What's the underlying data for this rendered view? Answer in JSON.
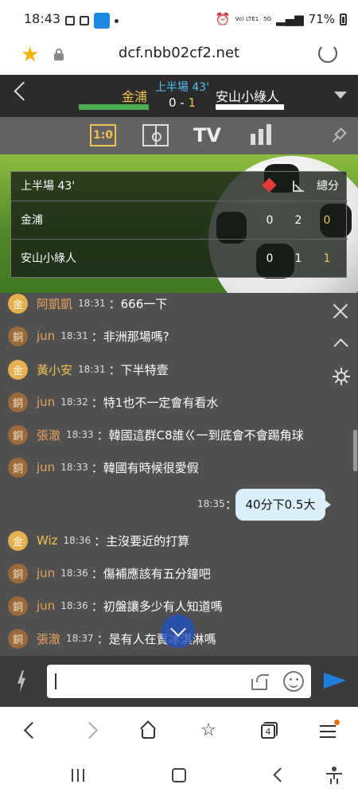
{
  "status_bar": {
    "time": "18:43",
    "lte_label": "Vo) LTE1",
    "net_label": "5G",
    "battery": "71%"
  },
  "browser": {
    "url": "dcf.nbb02cf2.net"
  },
  "match": {
    "home_team": "金浦",
    "away_team": "安山小綠人",
    "period": "上半場 43'",
    "home_score": "0",
    "score_sep": " - ",
    "away_score": "1"
  },
  "tabs": {
    "score_label": "1:0",
    "tv_label": "TV"
  },
  "scoreboard": {
    "period": "上半場 43'",
    "total_header": "總分",
    "rows": [
      {
        "team": "金浦",
        "red_cards": "0",
        "corners": "2",
        "total": "0"
      },
      {
        "team": "安山小綠人",
        "red_cards": "0",
        "corners": "1",
        "total": "1"
      }
    ]
  },
  "chat": {
    "messages": [
      {
        "badge": "金",
        "user": "阿凱凱",
        "time": "18:31",
        "text": "：666一下"
      },
      {
        "badge": "銅",
        "user": "jun",
        "time": "18:31",
        "text": "：非洲那場嗎?"
      },
      {
        "badge": "金",
        "user": "黃小安",
        "time": "18:31",
        "text": "：下半特壹"
      },
      {
        "badge": "銅",
        "user": "jun",
        "time": "18:32",
        "text": "：特1也不一定會有看水"
      },
      {
        "badge": "銅",
        "user": "張澈",
        "time": "18:33",
        "text": "：韓國這群C8誰ㄍ一到底會不會踢角球"
      },
      {
        "badge": "銅",
        "user": "jun",
        "time": "18:33",
        "text": "：韓國有時候很愛假"
      },
      {
        "badge": "金",
        "user": "Wiz",
        "time": "18:36",
        "text": "：主沒要近的打算"
      },
      {
        "badge": "銅",
        "user": "jun",
        "time": "18:36",
        "text": "：傷補應該有五分鐘吧"
      },
      {
        "badge": "銅",
        "user": "jun",
        "time": "18:36",
        "text": "：初盤讓多少有人知道嗎"
      },
      {
        "badge": "銅",
        "user": "張澈",
        "time": "18:37",
        "text": "：是有人在賣冰淇淋嗎"
      }
    ],
    "own_message": {
      "time": "18:35",
      "colon": "：",
      "text": "40分下0.5大"
    }
  },
  "input": {
    "value": "",
    "placeholder": ""
  },
  "browser_nav": {
    "tab_count": "4"
  },
  "colors": {
    "gold": "#f0c14b",
    "header_bg": "#2b2b2b",
    "chat_bg": "#505050",
    "send_blue": "#1e7fe0"
  }
}
